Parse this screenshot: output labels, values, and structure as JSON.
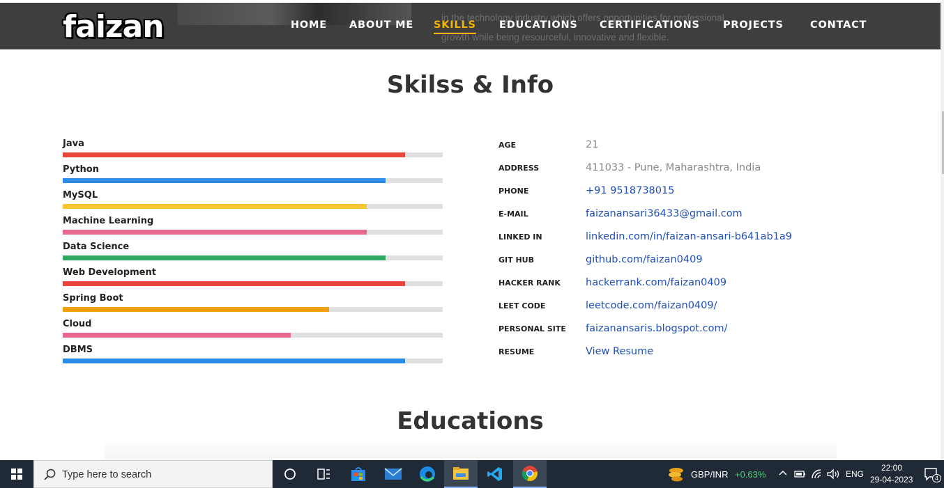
{
  "header": {
    "logo": "faizan",
    "bg_text_line1": "in the technology industry which offers opportunities for professional",
    "bg_text_line2": "growth while being resourceful, innovative and flexible.",
    "nav": [
      {
        "label": "HOME"
      },
      {
        "label": "ABOUT ME"
      },
      {
        "label": "SKILLS",
        "active": true
      },
      {
        "label": "EDUCATIONS"
      },
      {
        "label": "CERTIFICATIONS"
      },
      {
        "label": "PROJECTS"
      },
      {
        "label": "CONTACT"
      }
    ]
  },
  "skills_section": {
    "title": "Skilss & Info",
    "skills": [
      {
        "name": "Java",
        "level": 90,
        "color": "#e8453c"
      },
      {
        "name": "Python",
        "level": 85,
        "color": "#2b8be6"
      },
      {
        "name": "MySQL",
        "level": 80,
        "color": "#f9c532"
      },
      {
        "name": "Machine Learning",
        "level": 80,
        "color": "#e8698f"
      },
      {
        "name": "Data Science",
        "level": 85,
        "color": "#2ea862"
      },
      {
        "name": "Web Development",
        "level": 90,
        "color": "#e8453c"
      },
      {
        "name": "Spring Boot",
        "level": 70,
        "color": "#f29f0f"
      },
      {
        "name": "Cloud",
        "level": 60,
        "color": "#e8698f"
      },
      {
        "name": "DBMS",
        "level": 90,
        "color": "#2b8be6"
      }
    ],
    "info": [
      {
        "label": "AGE",
        "value": "21",
        "link": false
      },
      {
        "label": "ADDRESS",
        "value": "411033 - Pune, Maharashtra, India",
        "link": false
      },
      {
        "label": "PHONE",
        "value": "+91 9518738015",
        "link": true
      },
      {
        "label": "E-MAIL",
        "value": "faizanansari36433@gmail.com",
        "link": true
      },
      {
        "label": "LINKED IN",
        "value": "linkedin.com/in/faizan-ansari-b641ab1a9",
        "link": true
      },
      {
        "label": "GIT HUB",
        "value": "github.com/faizan0409",
        "link": true
      },
      {
        "label": "HACKER RANK",
        "value": "hackerrank.com/faizan0409",
        "link": true
      },
      {
        "label": "LEET CODE",
        "value": "leetcode.com/faizan0409/",
        "link": true
      },
      {
        "label": "PERSONAL SITE",
        "value": "faizanansaris.blogspot.com/",
        "link": true
      },
      {
        "label": "RESUME",
        "value": "View Resume",
        "link": true
      }
    ]
  },
  "educations_section": {
    "title": "Educations"
  },
  "taskbar": {
    "search_placeholder": "Type here to search",
    "apps": [
      "cortana-icon",
      "task-view-icon",
      "store-icon",
      "mail-icon",
      "edge-icon",
      "file-explorer-icon",
      "vscode-icon",
      "chrome-icon"
    ],
    "currency_pair": "GBP/INR",
    "currency_change": "+0.63%",
    "language": "ENG",
    "time": "22:00",
    "date": "29-04-2023",
    "notification_count": "4"
  }
}
